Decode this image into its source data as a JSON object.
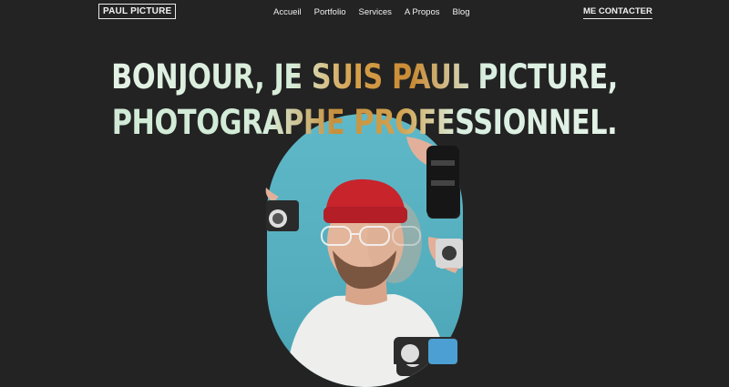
{
  "header": {
    "logo": "PAUL PICTURE",
    "nav": [
      "Accueil",
      "Portfolio",
      "Services",
      "A Propos",
      "Blog"
    ],
    "contact": "ME CONTACTER"
  },
  "hero": {
    "title_line1": "BONJOUR, JE SUIS PAUL PICTURE,",
    "title_line2": "PHOTOGRAPHE PROFESSIONNEL."
  },
  "colors": {
    "background": "#232323",
    "title_light": "#d6ecd8",
    "title_accent": "#c98a35",
    "photo_bg": "#5fb8c8",
    "beanie": "#c8242c"
  }
}
